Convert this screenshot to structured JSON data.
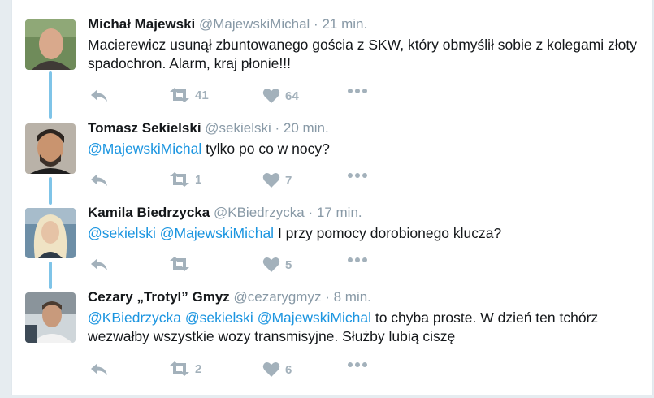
{
  "tweets": [
    {
      "name": "Michał Majewski",
      "handle": "@MajewskiMichal",
      "sep": "·",
      "time": "21 min.",
      "text": "Macierewicz usunął zbuntowanego gościa z SKW, który obmyślił sobie z kolegami złoty spadochron. Alarm, kraj płonie!!!",
      "mentions": [],
      "retweets": "41",
      "likes": "64"
    },
    {
      "name": "Tomasz Sekielski",
      "handle": "@sekielski",
      "sep": "·",
      "time": "20 min.",
      "mentions": [
        "@MajewskiMichal"
      ],
      "text": " tylko po co w nocy?",
      "retweets": "1",
      "likes": "7"
    },
    {
      "name": "Kamila Biedrzycka",
      "handle": "@KBiedrzycka",
      "sep": "·",
      "time": "17 min.",
      "mentions": [
        "@sekielski",
        "@MajewskiMichal"
      ],
      "text": " I przy pomocy dorobionego klucza?",
      "retweets": "",
      "likes": "5"
    },
    {
      "name": "Cezary „Trotyl” Gmyz",
      "handle": "@cezarygmyz",
      "sep": "·",
      "time": "8 min.",
      "mentions": [
        "@KBiedrzycka",
        "@sekielski",
        "@MajewskiMichal"
      ],
      "text": " to chyba proste. W dzień ten tchórz wezwałby wszystkie wozy transmisyjne. Służby lubią ciszę",
      "retweets": "2",
      "likes": "6"
    }
  ],
  "icons": {
    "reply": "reply-icon",
    "retweet": "retweet-icon",
    "like": "heart-icon",
    "more": "more-icon"
  },
  "colors": {
    "mention": "#1b95e0",
    "thread_line": "#7fc4e8",
    "action": "#a3b1bb"
  }
}
